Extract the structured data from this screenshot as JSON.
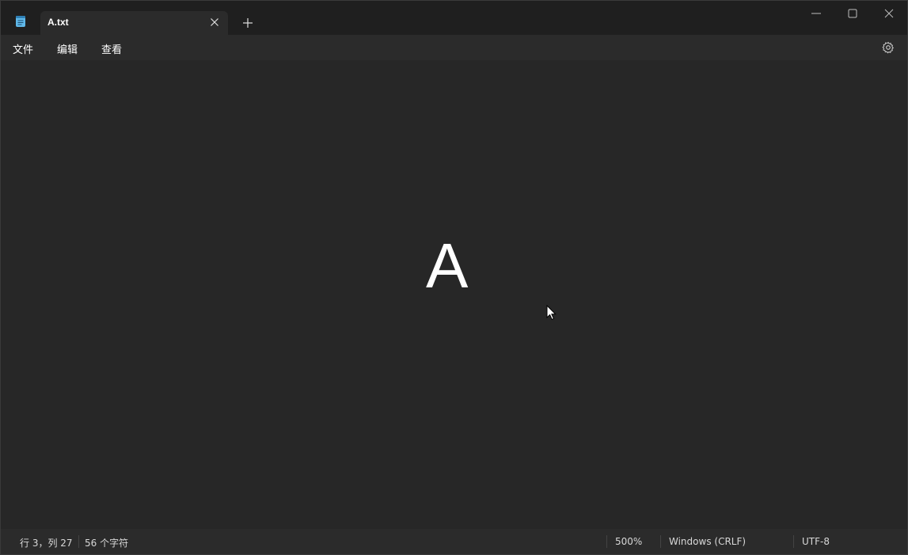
{
  "titlebar": {
    "tab_title": "A.txt",
    "icons": {
      "app": "notepad-icon",
      "tab_close": "close-icon",
      "new_tab": "plus-icon",
      "minimize": "minimize-icon",
      "maximize": "maximize-icon",
      "close": "close-icon"
    }
  },
  "menubar": {
    "file": "文件",
    "edit": "编辑",
    "view": "查看",
    "settings_icon": "gear-icon"
  },
  "editor": {
    "content": "A"
  },
  "statusbar": {
    "position": "行 3，列 27",
    "chars": "56 个字符",
    "zoom": "500%",
    "line_ending": "Windows (CRLF)",
    "encoding": "UTF-8"
  },
  "colors": {
    "titlebar_bg": "#1f1f1f",
    "tab_bg": "#2b2b2b",
    "editor_bg": "#272727",
    "text": "#ffffff",
    "app_icon_accent": "#5fb7e8"
  }
}
